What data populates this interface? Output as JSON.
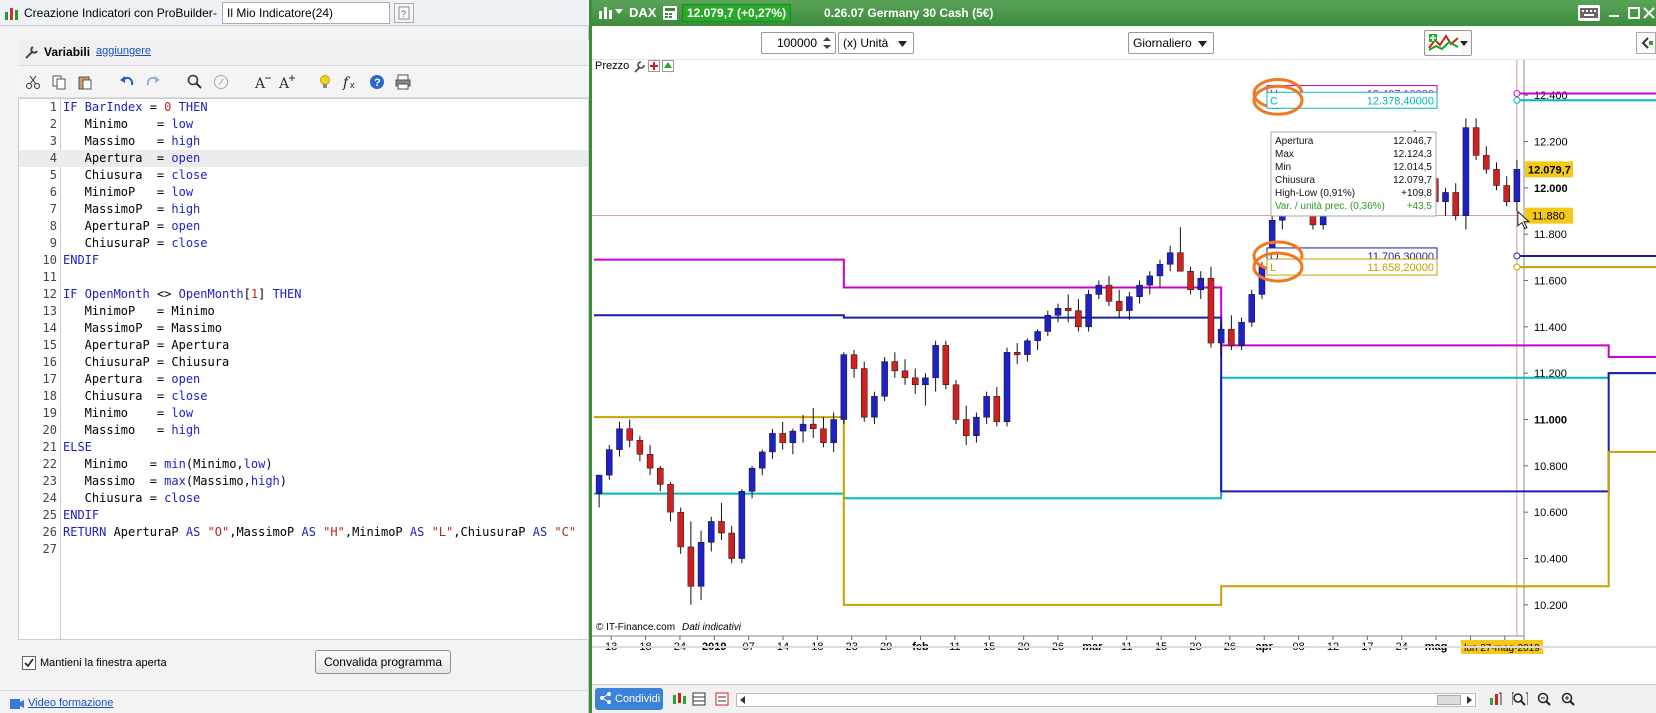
{
  "left": {
    "title": "Creazione Indicatori con ProBuilder",
    "title_sep": "-",
    "indicator_name": "Il Mio Indicatore(24)",
    "vars_label": "Variabili",
    "add_link": "aggiungere",
    "keep_open_label": "Mantieni la finestra aperta",
    "validate_button": "Convalida programma",
    "video_link": "Video formazione",
    "code_lines": [
      "IF BarIndex = 0 THEN",
      "   Minimo    = low",
      "   Massimo   = high",
      "   Apertura  = open",
      "   Chiusura  = close",
      "   MinimoP   = low",
      "   MassimoP  = high",
      "   AperturaP = open",
      "   ChiusuraP = close",
      "ENDIF",
      "",
      "IF OpenMonth <> OpenMonth[1] THEN",
      "   MinimoP   = Minimo",
      "   MassimoP  = Massimo",
      "   AperturaP = Apertura",
      "   ChiusuraP = Chiusura",
      "   Apertura  = open",
      "   Chiusura  = close",
      "   Minimo    = low",
      "   Massimo   = high",
      "ELSE",
      "   Minimo   = min(Minimo,low)",
      "   Massimo  = max(Massimo,high)",
      "   Chiusura = close",
      "ENDIF",
      "RETURN AperturaP AS \"O\",MassimoP AS \"H\",MinimoP AS \"L\",ChiusuraP AS \"C\"",
      ""
    ],
    "highlighted_line": 4
  },
  "right": {
    "symbol": "DAX",
    "price_badge": "12.079,7 (+0,27%)",
    "info": "0.26.07  Germany 30 Cash (5€)",
    "qty_value": "100000",
    "unit_select": "(x) Unità",
    "period_select": "Giornaliero",
    "prezzo_label": "Prezzo",
    "copyright": "© IT-Finance.com",
    "copyright_note": "Dati indicativi",
    "share_button": "Condividi",
    "date_badge": "lun 27-mag-2019",
    "y_ticks": [
      "12.400",
      "12.200",
      "12.000",
      "11.800",
      "11.600",
      "11.400",
      "11.200",
      "11.000",
      "10.800",
      "10.600",
      "10.400",
      "10.200"
    ],
    "x_ticks": [
      {
        "t": "13",
        "b": false
      },
      {
        "t": "18",
        "b": false
      },
      {
        "t": "24",
        "b": false
      },
      {
        "t": "2019",
        "b": true
      },
      {
        "t": "07",
        "b": false
      },
      {
        "t": "14",
        "b": false
      },
      {
        "t": "18",
        "b": false
      },
      {
        "t": "23",
        "b": false
      },
      {
        "t": "29",
        "b": false
      },
      {
        "t": "feb",
        "b": true
      },
      {
        "t": "11",
        "b": false
      },
      {
        "t": "15",
        "b": false
      },
      {
        "t": "20",
        "b": false
      },
      {
        "t": "26",
        "b": false
      },
      {
        "t": "mar",
        "b": true
      },
      {
        "t": "11",
        "b": false
      },
      {
        "t": "15",
        "b": false
      },
      {
        "t": "20",
        "b": false
      },
      {
        "t": "26",
        "b": false
      },
      {
        "t": "apr",
        "b": true
      },
      {
        "t": "08",
        "b": false
      },
      {
        "t": "12",
        "b": false
      },
      {
        "t": "17",
        "b": false
      },
      {
        "t": "24",
        "b": false
      },
      {
        "t": "mag",
        "b": true
      },
      {
        "t": "06",
        "b": false
      },
      {
        "t": "13",
        "b": false
      }
    ],
    "last_price_label": "12.079,7",
    "cursor_price_label": "11.880",
    "indicator_labels": [
      {
        "tag": "H",
        "value": "12.407,10000",
        "color": "#cc00cc"
      },
      {
        "tag": "C",
        "value": "12.378,40000",
        "color": "#00b8b8"
      },
      {
        "tag": "O",
        "value": "11.706,30000",
        "color": "#1c1caa"
      },
      {
        "tag": "L",
        "value": "11.658,20000",
        "color": "#c8a000"
      }
    ],
    "tooltip": [
      {
        "k": "Apertura",
        "v": "12.046,7"
      },
      {
        "k": "Max",
        "v": "12.124,3"
      },
      {
        "k": "Min",
        "v": "12.014,5"
      },
      {
        "k": "Chiusura",
        "v": "12.079,7"
      },
      {
        "k": "High-Low (0,91%)",
        "v": "+109,8"
      },
      {
        "k": "Var. / unità prec. (0,36%)",
        "v": "+43,5",
        "green": true
      }
    ]
  },
  "chart_data": {
    "type": "candlestick",
    "title": "DAX",
    "ylim": [
      10100,
      12500
    ],
    "levels": [
      {
        "name": "H",
        "color": "#cc00cc",
        "steps": [
          [
            0,
            11690
          ],
          [
            24,
            11570
          ],
          [
            61,
            11320
          ],
          [
            99,
            11270
          ],
          [
            134,
            11390
          ],
          [
            142,
            12407
          ]
        ]
      },
      {
        "name": "C",
        "color": "#00b8b8",
        "steps": [
          [
            0,
            10680
          ],
          [
            24,
            10660
          ],
          [
            61,
            11180
          ],
          [
            99,
            11200
          ],
          [
            134,
            11520
          ],
          [
            142,
            12378
          ]
        ]
      },
      {
        "name": "O",
        "color": "#1c1caa",
        "steps": [
          [
            0,
            11450
          ],
          [
            24,
            11440
          ],
          [
            61,
            10690
          ],
          [
            99,
            11200
          ],
          [
            134,
            11520
          ],
          [
            142,
            11706
          ]
        ]
      },
      {
        "name": "L",
        "color": "#c8a000",
        "steps": [
          [
            0,
            11010
          ],
          [
            24,
            10200
          ],
          [
            61,
            10280
          ],
          [
            99,
            10860
          ],
          [
            134,
            11270
          ],
          [
            142,
            11658
          ]
        ]
      }
    ],
    "candles": [
      [
        10680,
        10760,
        10620,
        10760
      ],
      [
        10760,
        10890,
        10740,
        10870
      ],
      [
        10870,
        10990,
        10840,
        10960
      ],
      [
        10960,
        11000,
        10880,
        10910
      ],
      [
        10910,
        10930,
        10820,
        10850
      ],
      [
        10850,
        10890,
        10760,
        10790
      ],
      [
        10790,
        10800,
        10690,
        10720
      ],
      [
        10720,
        10730,
        10560,
        10600
      ],
      [
        10600,
        10620,
        10420,
        10450
      ],
      [
        10450,
        10560,
        10200,
        10280
      ],
      [
        10280,
        10520,
        10220,
        10470
      ],
      [
        10470,
        10580,
        10430,
        10560
      ],
      [
        10560,
        10640,
        10480,
        10510
      ],
      [
        10510,
        10540,
        10380,
        10400
      ],
      [
        10400,
        10700,
        10380,
        10690
      ],
      [
        10690,
        10800,
        10660,
        10790
      ],
      [
        10790,
        10870,
        10760,
        10860
      ],
      [
        10860,
        10960,
        10830,
        10940
      ],
      [
        10940,
        10990,
        10870,
        10900
      ],
      [
        10900,
        10960,
        10850,
        10950
      ],
      [
        10950,
        11020,
        10900,
        10980
      ],
      [
        10980,
        11050,
        10920,
        10960
      ],
      [
        10960,
        11010,
        10880,
        10900
      ],
      [
        10900,
        11030,
        10860,
        11000
      ],
      [
        11000,
        11290,
        10980,
        11280
      ],
      [
        11280,
        11300,
        11180,
        11220
      ],
      [
        11220,
        11250,
        10990,
        11010
      ],
      [
        11010,
        11120,
        10980,
        11100
      ],
      [
        11100,
        11270,
        11080,
        11250
      ],
      [
        11250,
        11290,
        11180,
        11210
      ],
      [
        11210,
        11260,
        11150,
        11180
      ],
      [
        11180,
        11220,
        11110,
        11150
      ],
      [
        11150,
        11200,
        11060,
        11180
      ],
      [
        11180,
        11340,
        11120,
        11320
      ],
      [
        11320,
        11340,
        11130,
        11150
      ],
      [
        11150,
        11170,
        10980,
        11000
      ],
      [
        11000,
        11060,
        10890,
        10930
      ],
      [
        10930,
        11030,
        10900,
        11010
      ],
      [
        11010,
        11120,
        10980,
        11100
      ],
      [
        11100,
        11140,
        10970,
        10990
      ],
      [
        10990,
        11310,
        10970,
        11290
      ],
      [
        11290,
        11330,
        11240,
        11280
      ],
      [
        11280,
        11350,
        11250,
        11340
      ],
      [
        11340,
        11390,
        11300,
        11380
      ],
      [
        11380,
        11470,
        11360,
        11450
      ],
      [
        11450,
        11500,
        11420,
        11480
      ],
      [
        11480,
        11540,
        11420,
        11470
      ],
      [
        11470,
        11520,
        11380,
        11400
      ],
      [
        11400,
        11560,
        11380,
        11540
      ],
      [
        11540,
        11600,
        11520,
        11580
      ],
      [
        11580,
        11620,
        11490,
        11510
      ],
      [
        11510,
        11560,
        11440,
        11470
      ],
      [
        11470,
        11550,
        11430,
        11530
      ],
      [
        11530,
        11600,
        11500,
        11580
      ],
      [
        11580,
        11640,
        11540,
        11620
      ],
      [
        11620,
        11690,
        11570,
        11670
      ],
      [
        11670,
        11750,
        11640,
        11720
      ],
      [
        11720,
        11830,
        11700,
        11640
      ],
      [
        11640,
        11660,
        11540,
        11560
      ],
      [
        11560,
        11640,
        11520,
        11610
      ],
      [
        11610,
        11660,
        11310,
        11330
      ],
      [
        11330,
        11410,
        11270,
        11390
      ],
      [
        11390,
        11450,
        11300,
        11320
      ],
      [
        11320,
        11440,
        11300,
        11420
      ],
      [
        11420,
        11560,
        11400,
        11540
      ],
      [
        11540,
        11680,
        11520,
        11660
      ],
      [
        11660,
        11880,
        11640,
        11860
      ],
      [
        11860,
        11960,
        11820,
        11940
      ],
      [
        11940,
        12020,
        11900,
        11980
      ],
      [
        11980,
        12000,
        11880,
        11900
      ],
      [
        11900,
        11960,
        11820,
        11840
      ],
      [
        11840,
        12030,
        11820,
        12010
      ],
      [
        12010,
        12080,
        11980,
        12060
      ],
      [
        12060,
        12150,
        12030,
        12130
      ],
      [
        12130,
        12190,
        12090,
        12170
      ],
      [
        12170,
        12210,
        12100,
        12150
      ],
      [
        12150,
        12190,
        12080,
        12110
      ],
      [
        12110,
        12160,
        12060,
        12140
      ],
      [
        12140,
        12200,
        12110,
        12180
      ],
      [
        12180,
        12240,
        12140,
        12200
      ],
      [
        12200,
        12250,
        12120,
        12140
      ],
      [
        12140,
        12170,
        12020,
        12040
      ],
      [
        12040,
        12080,
        11920,
        11940
      ],
      [
        11940,
        12000,
        11880,
        11980
      ],
      [
        11980,
        12020,
        11860,
        11880
      ],
      [
        11880,
        12300,
        11820,
        12260
      ],
      [
        12260,
        12300,
        12120,
        12140
      ],
      [
        12140,
        12180,
        12060,
        12080
      ],
      [
        12080,
        12110,
        11990,
        12010
      ],
      [
        12010,
        12050,
        11920,
        11940
      ],
      [
        11940,
        12120,
        11900,
        12080
      ]
    ]
  }
}
